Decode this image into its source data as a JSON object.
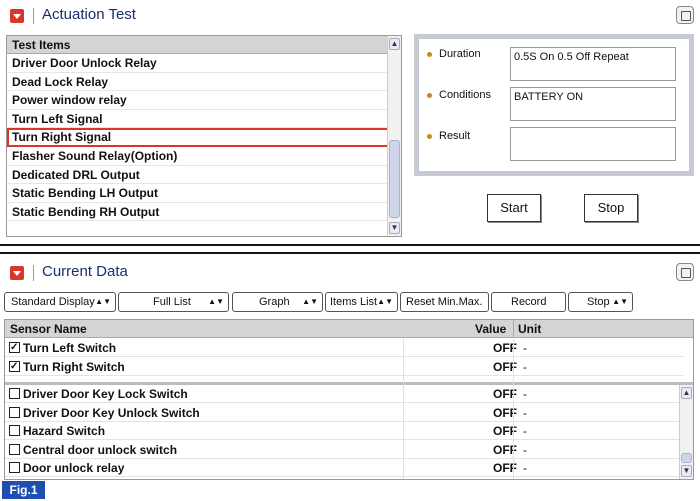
{
  "actuation": {
    "title": "Actuation Test",
    "list_header": "Test Items",
    "items": [
      "Driver Door Unlock Relay",
      "Dead Lock Relay",
      "Power window relay",
      "Turn Left Signal",
      "Turn Right Signal",
      "Flasher Sound Relay(Option)",
      "Dedicated DRL Output",
      "Static Bending LH Output",
      "Static Bending RH Output"
    ],
    "selected_item": "Turn Right Signal",
    "duration_label": "Duration",
    "duration_value": "0.5S On 0.5 Off Repeat",
    "conditions_label": "Conditions",
    "conditions_value": "BATTERY ON",
    "result_label": "Result",
    "result_value": "",
    "start_label": "Start",
    "stop_label": "Stop"
  },
  "current_data": {
    "title": "Current Data",
    "toolbar": {
      "standard_display": "Standard Display",
      "full_list": "Full List",
      "graph": "Graph",
      "items_list": "Items List",
      "reset_minmax": "Reset Min.Max.",
      "record": "Record",
      "stop": "Stop"
    },
    "col_sensor": "Sensor Name",
    "col_value": "Value",
    "col_unit": "Unit",
    "pinned_rows": [
      {
        "name": "Turn Left Switch",
        "value": "OFF",
        "unit": "-",
        "checked": true
      },
      {
        "name": "Turn Right Switch",
        "value": "OFF",
        "unit": "-",
        "checked": true
      }
    ],
    "rows": [
      {
        "name": "Driver Door Key Lock Switch",
        "value": "OFF",
        "unit": "-",
        "checked": false
      },
      {
        "name": "Driver Door Key Unlock Switch",
        "value": "OFF",
        "unit": "-",
        "checked": false
      },
      {
        "name": "Hazard Switch",
        "value": "OFF",
        "unit": "-",
        "checked": false
      },
      {
        "name": "Central door unlock switch",
        "value": "OFF",
        "unit": "-",
        "checked": false
      },
      {
        "name": "Door unlock relay",
        "value": "OFF",
        "unit": "-",
        "checked": false
      }
    ]
  },
  "figure_label": "Fig.1",
  "colors": {
    "accent": "#d9372a",
    "title": "#1a2f6a",
    "figure": "#1e4fb0",
    "bullet": "#c8861e"
  }
}
